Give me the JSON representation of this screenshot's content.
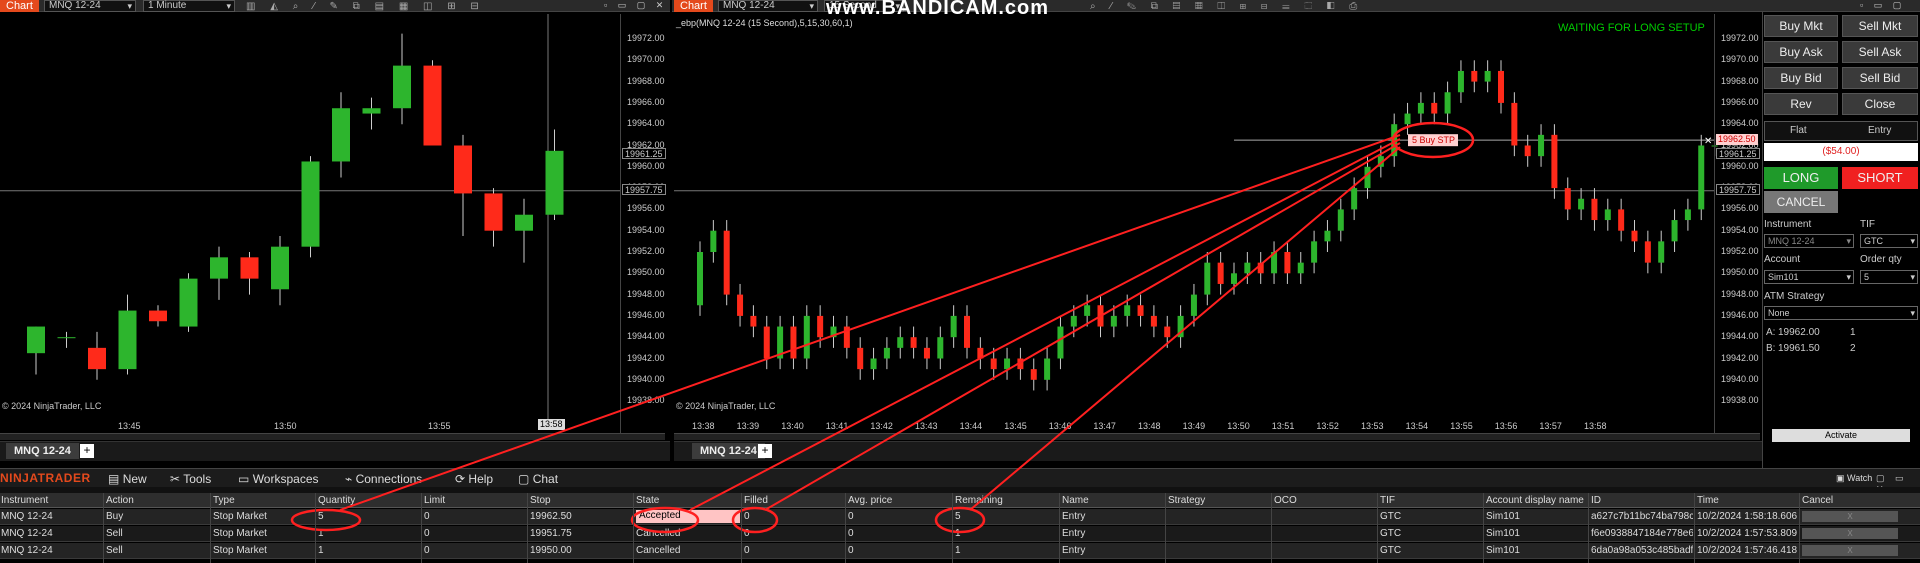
{
  "watermark": "www.BANDICAM.com",
  "left_chart": {
    "tab_label": "Chart",
    "instrument_select": "MNQ 12-24",
    "interval_select": "1 Minute",
    "y_ticks": [
      "19972.00",
      "19970.00",
      "19968.00",
      "19966.00",
      "19964.00",
      "19962.00",
      "19960.00",
      "19958.00",
      "19956.00",
      "19954.00",
      "19952.00",
      "19950.00",
      "19948.00",
      "19946.00",
      "19944.00",
      "19942.00",
      "19940.00",
      "19938.00"
    ],
    "x_ticks": [
      "13:45",
      "13:50",
      "13:55"
    ],
    "x_cursor_label": "13:58",
    "price_marker_upper": "19961.25",
    "price_marker_lower": "19957.75",
    "copyright": "© 2024 NinjaTrader, LLC",
    "instrument_tab": "MNQ 12-24",
    "candles": [
      {
        "o": 19942.5,
        "h": 19945.0,
        "l": 19940.5,
        "c": 19945.0
      },
      {
        "o": 19944.0,
        "h": 19944.5,
        "l": 19943.0,
        "c": 19944.0
      },
      {
        "o": 19943.0,
        "h": 19944.5,
        "l": 19940.0,
        "c": 19941.0
      },
      {
        "o": 19941.0,
        "h": 19948.0,
        "l": 19940.5,
        "c": 19946.5
      },
      {
        "o": 19946.5,
        "h": 19947.0,
        "l": 19945.0,
        "c": 19945.5
      },
      {
        "o": 19945.0,
        "h": 19950.0,
        "l": 19944.5,
        "c": 19949.5
      },
      {
        "o": 19949.5,
        "h": 19952.5,
        "l": 19947.5,
        "c": 19951.5
      },
      {
        "o": 19951.5,
        "h": 19952.0,
        "l": 19948.0,
        "c": 19949.5
      },
      {
        "o": 19948.5,
        "h": 19953.5,
        "l": 19947.0,
        "c": 19952.5
      },
      {
        "o": 19952.5,
        "h": 19961.0,
        "l": 19951.5,
        "c": 19960.5
      },
      {
        "o": 19960.5,
        "h": 19967.0,
        "l": 19959.0,
        "c": 19965.5
      },
      {
        "o": 19965.0,
        "h": 19966.5,
        "l": 19963.5,
        "c": 19965.5
      },
      {
        "o": 19965.5,
        "h": 19972.5,
        "l": 19964.0,
        "c": 19969.5
      },
      {
        "o": 19969.5,
        "h": 19970.0,
        "l": 19962.0,
        "c": 19962.0
      },
      {
        "o": 19962.0,
        "h": 19963.0,
        "l": 19953.5,
        "c": 19957.5
      },
      {
        "o": 19957.5,
        "h": 19958.0,
        "l": 19952.5,
        "c": 19954.0
      },
      {
        "o": 19954.0,
        "h": 19957.0,
        "l": 19951.0,
        "c": 19955.5
      },
      {
        "o": 19955.5,
        "h": 19963.5,
        "l": 19955.0,
        "c": 19961.5
      }
    ]
  },
  "right_chart": {
    "tab_label": "Chart",
    "instrument_select": "MNQ 12-24",
    "interval_select": "15 Second",
    "indicator_label": "_ebp(MNQ 12-24 (15 Second),5,15,30,60,1)",
    "status_text": "WAITING FOR LONG SETUP",
    "order_tag": "5 Buy STP",
    "order_price_label": "19962.50",
    "price_marker_upper": "19961.25",
    "price_marker_lower": "19957.75",
    "y_ticks": [
      "19972.00",
      "19970.00",
      "19968.00",
      "19966.00",
      "19964.00",
      "19962.00",
      "19960.00",
      "19958.00",
      "19956.00",
      "19954.00",
      "19952.00",
      "19950.00",
      "19948.00",
      "19946.00",
      "19944.00",
      "19942.00",
      "19940.00",
      "19938.00"
    ],
    "x_ticks": [
      "13:38",
      "13:39",
      "13:40",
      "13:41",
      "13:42",
      "13:43",
      "13:44",
      "13:45",
      "13:46",
      "13:47",
      "13:48",
      "13:49",
      "13:50",
      "13:51",
      "13:52",
      "13:53",
      "13:54",
      "13:55",
      "13:56",
      "13:57",
      "13:58"
    ],
    "copyright": "© 2024 NinjaTrader, LLC",
    "instrument_tab": "MNQ 12-24"
  },
  "chart_trader": {
    "buttons": [
      "Buy Mkt",
      "Sell Mkt",
      "Buy Ask",
      "Sell Ask",
      "Buy Bid",
      "Sell Bid",
      "Rev",
      "Close"
    ],
    "position_col1": "Flat",
    "position_col2": "Entry",
    "pnl": "($54.00)",
    "long_label": "LONG",
    "short_label": "SHORT",
    "cancel_label": "CANCEL",
    "instrument_label": "Instrument",
    "instrument_value": "MNQ 12-24",
    "tif_label": "TIF",
    "tif_value": "GTC",
    "account_label": "Account",
    "account_value": "Sim101",
    "qty_label": "Order qty",
    "qty_value": "5",
    "atm_label": "ATM Strategy",
    "atm_value": "None",
    "ask_label": "A:",
    "ask_price": "19962.00",
    "ask_size": "1",
    "bid_label": "B:",
    "bid_price": "19961.50",
    "bid_size": "2",
    "activate_label": "Activate"
  },
  "control_center": {
    "logo": "NINJATRADER",
    "menu": [
      "New",
      "Tools",
      "Workspaces",
      "Connections",
      "Help",
      "Chat"
    ],
    "watch_label": "Watch",
    "columns": [
      "Instrument",
      "Action",
      "Type",
      "Quantity",
      "Limit",
      "Stop",
      "State",
      "Filled",
      "Avg. price",
      "Remaining",
      "Name",
      "Strategy",
      "OCO",
      "TIF",
      "Account display name",
      "ID",
      "Time",
      "Cancel"
    ],
    "rows": [
      [
        "MNQ 12-24",
        "Buy",
        "Stop Market",
        "5",
        "0",
        "19962.50",
        "Accepted",
        "0",
        "0",
        "5",
        "Entry",
        "",
        "",
        "GTC",
        "Sim101",
        "a627c7b11bc74ba798cf",
        "10/2/2024 1:58:18.606 P",
        "X"
      ],
      [
        "MNQ 12-24",
        "Sell",
        "Stop Market",
        "1",
        "0",
        "19951.75",
        "Cancelled",
        "0",
        "0",
        "1",
        "Entry",
        "",
        "",
        "GTC",
        "Sim101",
        "f6e0938847184e778e62",
        "10/2/2024 1:57:53.809 P",
        "X"
      ],
      [
        "MNQ 12-24",
        "Sell",
        "Stop Market",
        "1",
        "0",
        "19950.00",
        "Cancelled",
        "0",
        "0",
        "1",
        "Entry",
        "",
        "",
        "GTC",
        "Sim101",
        "6da0a98a053c485badf4",
        "10/2/2024 1:57:46.418 P",
        "X"
      ]
    ]
  },
  "colors": {
    "up": "#2db52d",
    "down": "#ff2a1a",
    "accent": "#e4491c",
    "annotation": "#ff2020",
    "status": "#00cc00"
  }
}
